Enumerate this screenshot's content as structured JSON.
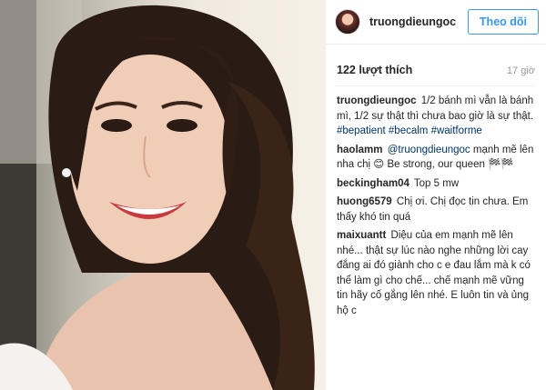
{
  "post": {
    "username": "truongdieungoc",
    "follow_label": "Theo dõi",
    "likes": "122 lượt thích",
    "time": "17 giờ"
  },
  "caption": {
    "user": "truongdieungoc",
    "text": "1/2 bánh mì vẫn là bánh mì, 1/2 sự thật thì chưa bao giờ là sự thật.",
    "hashtags": "#bepatient #becalm #waitforme"
  },
  "comments": [
    {
      "user": "haolamm",
      "mention": "@truongdieungoc",
      "text": " mạnh mẽ lên nha chị 😊 Be strong, our queen 🏁🏁"
    },
    {
      "user": "beckingham04",
      "text": "Top 5 mw"
    },
    {
      "user": "huong6579",
      "text": "Chị ơi. Chị đọc tin chưa. Em thấy khó tin quá"
    },
    {
      "user": "maixuantt",
      "text": "Diệu của em mạnh mẽ lên nhé... thật sự lúc nào nghe những lời cay đắng ai đó giành cho c e đau lắm mà k có thể làm gì cho chế... chế mạnh mẽ vững tin hãy cố gắng lên nhé. E luôn tin và ủng hộ c"
    }
  ],
  "icons": {
    "avatar": "profile-avatar"
  }
}
